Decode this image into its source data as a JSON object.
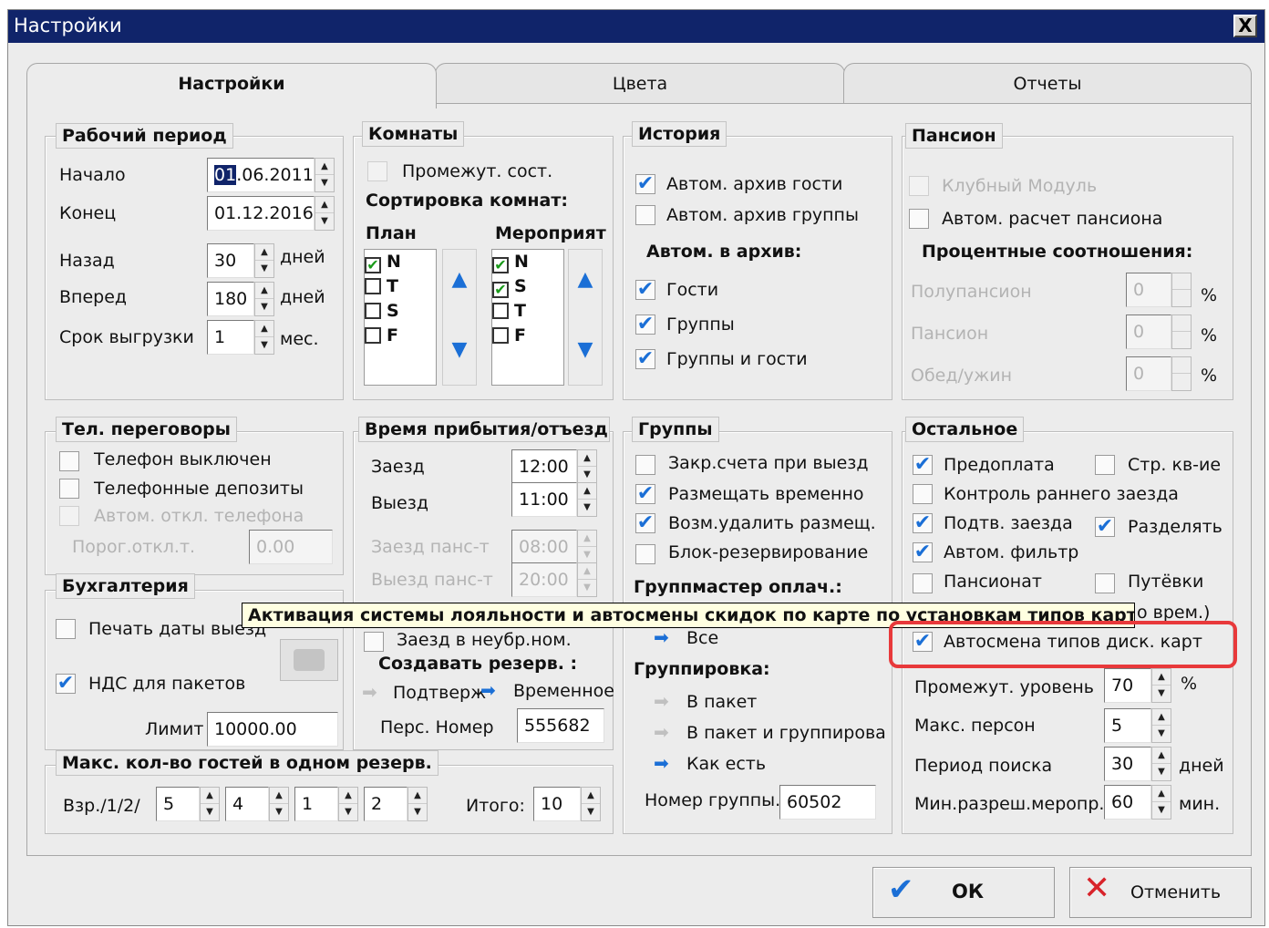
{
  "window": {
    "title": "Настройки",
    "close_label": "X"
  },
  "tabs": [
    "Настройки",
    "Цвета",
    "Отчеты"
  ],
  "work_period": {
    "title": "Рабочий период",
    "start_label": "Начало",
    "start_value_day": "01",
    "start_value_rest": ".06.2011",
    "end_label": "Конец",
    "end_value": "01.12.2016",
    "back_label": "Назад",
    "back_value": "30",
    "back_unit": "дней",
    "forward_label": "Вперед",
    "forward_value": "180",
    "forward_unit": "дней",
    "export_label": "Срок выгрузки",
    "export_value": "1",
    "export_unit": "мес."
  },
  "rooms": {
    "title": "Комнаты",
    "intermediate_label": "Промежут. сост.",
    "sorting_label": "Сортировка комнат:",
    "plan_label": "План",
    "events_label": "Мероприят",
    "plan_items": [
      {
        "label": "N",
        "checked": true
      },
      {
        "label": "T",
        "checked": false
      },
      {
        "label": "S",
        "checked": false
      },
      {
        "label": "F",
        "checked": false
      }
    ],
    "event_items": [
      {
        "label": "N",
        "checked": true
      },
      {
        "label": "S",
        "checked": true
      },
      {
        "label": "T",
        "checked": false
      },
      {
        "label": "F",
        "checked": false
      }
    ]
  },
  "history": {
    "title": "История",
    "auto_archive_guests": "Автом. архив гости",
    "auto_archive_groups": "Автом. архив группы",
    "auto_to_archive": "Автом. в архив:",
    "guests": "Гости",
    "groups": "Группы",
    "groups_and_guests": "Группы и гости"
  },
  "pension": {
    "title": "Пансион",
    "club_module": "Клубный Модуль",
    "auto_calc": "Автом. расчет пансиона",
    "ratios_label": "Процентные соотношения:",
    "half_board": "Полупансион",
    "half_board_value": "0",
    "full_board": "Пансион",
    "full_board_value": "0",
    "lunch_dinner": "Обед/ужин",
    "lunch_dinner_value": "0",
    "percent": "%"
  },
  "phone": {
    "title": "Тел. переговоры",
    "phone_off": "Телефон выключен",
    "phone_deposits": "Телефонные депозиты",
    "auto_off": "Автом. откл. телефона",
    "threshold_label": "Порог.откл.т.",
    "threshold_value": "0.00"
  },
  "accounting": {
    "title": "Бухгалтерия",
    "print_dates": "Печать даты выезд",
    "vat_packages": "НДС для пакетов",
    "limit_label": "Лимит",
    "limit_value": "10000.00"
  },
  "arrival": {
    "title": "Время прибытия/отъезд.",
    "checkin_label": "Заезд",
    "checkin_value": "12:00",
    "checkout_label": "Выезд",
    "checkout_value": "11:00",
    "checkin_pension_label": "Заезд панс-т",
    "checkin_pension_value": "08:00",
    "checkout_pension_label": "Выезд панс-т",
    "checkout_pension_value": "20:00",
    "unprep_checkin": "Заезд в неубр.ном.",
    "create_reserve": "Создавать резерв. :",
    "confirmed": "Подтверж",
    "temporary": "Временное",
    "pers_number_label": "Перс. Номер",
    "pers_number_value": "555682"
  },
  "groups": {
    "title": "Группы",
    "close_accounts": "Закр.счета при выезд",
    "place_temp": "Размещать временно",
    "can_delete": "Возм.удалить размещ.",
    "block_reserve": "Блок-резервирование",
    "groupmaster_label": "Группмастер оплач.:",
    "all": "Все",
    "grouping_label": "Группировка:",
    "in_package": "В пакет",
    "in_package_grouping": "В пакет и группировать",
    "as_is": "Как есть",
    "group_number_label": "Номер группы.",
    "group_number_value": "60502"
  },
  "other": {
    "title": "Остальное",
    "prepayment": "Предоплата",
    "insurance": "Стр. кв-ие",
    "early_checkin": "Контроль раннего заезда",
    "confirm_checkin": "Подтв. заезда",
    "split": "Разделять",
    "auto_filter": "Автом. фильтр",
    "boarding": "Пансионат",
    "vouchers": "Путёвки",
    "tmp_suffix": "о врем.)",
    "auto_change_cards": "Автосмена типов диск. карт",
    "intermediate_level_label": "Промежут. уровень",
    "intermediate_level_value": "70",
    "percent": "%",
    "max_persons_label": "Макс. персон",
    "max_persons_value": "5",
    "search_period_label": "Период поиска",
    "search_period_value": "30",
    "search_period_unit": "дней",
    "min_event_label": "Мин.разреш.меропр.",
    "min_event_value": "60",
    "min_event_unit": "мин."
  },
  "max_guests": {
    "title": "Макс. кол-во гостей в одном резерв.",
    "label": "Взр./1/2/",
    "v1": "5",
    "v2": "4",
    "v3": "1",
    "v4": "2",
    "total_label": "Итого:",
    "total_value": "10"
  },
  "tooltip": {
    "text": "Активация системы лояльности и автосмены скидок по карте по установкам типов карт"
  },
  "buttons": {
    "ok": "ОК",
    "cancel": "Отменить"
  },
  "colors": {
    "titlebar": "#10246a",
    "accent": "#1b6fd6",
    "highlight": "#e8393b",
    "tooltip_bg": "#ffffe1"
  }
}
